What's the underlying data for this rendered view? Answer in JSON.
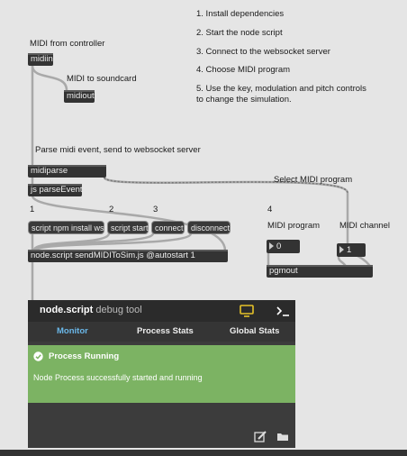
{
  "instructions": [
    "1. Install dependencies",
    "2. Start the node script",
    "3. Connect to the websocket server",
    "4. Choose MIDI program",
    "5. Use the key, modulation and pitch controls to change the simulation."
  ],
  "comments": {
    "midi_from_controller": "MIDI from controller",
    "midi_to_soundcard": "MIDI to soundcard",
    "parse_midi": "Parse midi event, send to websocket server",
    "select_program": "Select MIDI program",
    "midi_program": "MIDI program",
    "midi_channel": "MIDI channel",
    "step1": "1",
    "step2": "2",
    "step3": "3",
    "step4": "4"
  },
  "objects": {
    "midiin": "midiin",
    "midiout": "midiout",
    "midiparse": "midiparse",
    "js_parse": "js parseEvent",
    "node_script": "node.script sendMIDIToSim.js @autostart 1",
    "pgmout": "pgmout"
  },
  "messages": {
    "install": "script npm install ws",
    "start": "script start",
    "connect": "connect",
    "disconnect": "disconnect"
  },
  "numbers": {
    "program": "0",
    "channel": "1"
  },
  "debug": {
    "title_bold": "node.script",
    "title_rest": " debug tool",
    "tabs": [
      "Monitor",
      "Process Stats",
      "Global Stats"
    ],
    "active_tab": "Monitor",
    "status_title": "Process Running",
    "status_text": "Node Process successfully started and running",
    "accent": "#6ab7e8",
    "status_color": "#7cb363",
    "icons": [
      "monitor-icon",
      "terminal-icon",
      "edit-icon",
      "folder-icon",
      "check-circle-icon"
    ]
  }
}
